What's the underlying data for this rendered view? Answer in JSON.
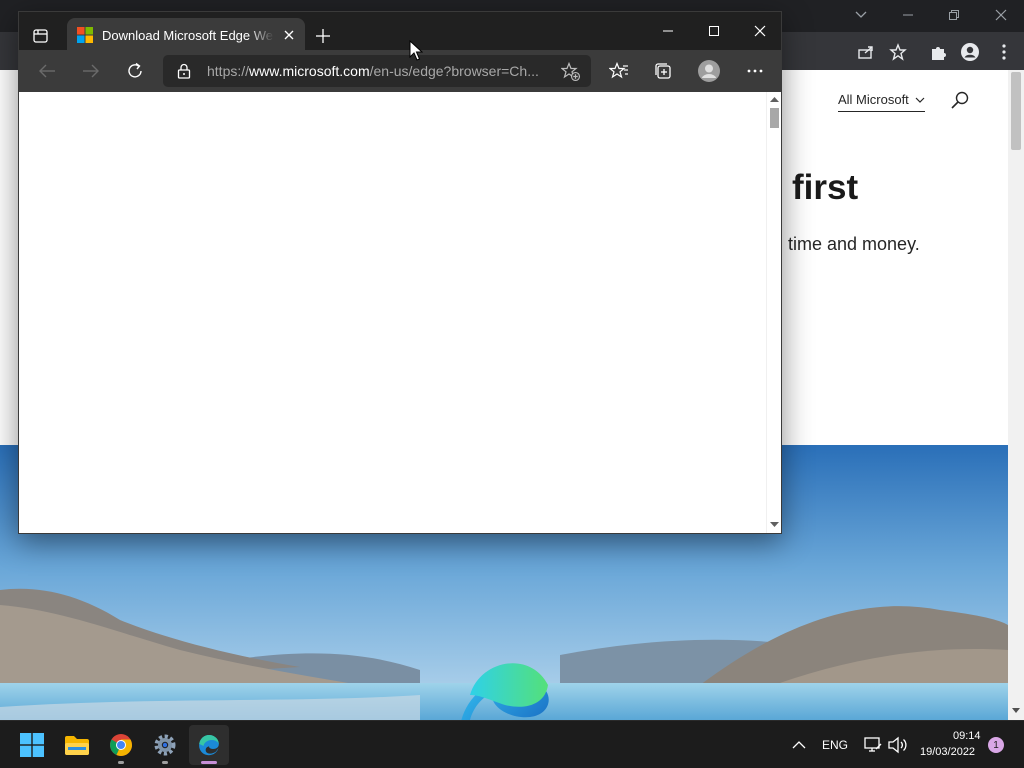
{
  "background_window": {
    "nav_label": "All Microsoft",
    "heading": "first",
    "subtext": "time and money."
  },
  "edge": {
    "tab_title": "Download Microsoft Edge Web Browser | Microsoft",
    "url_prefix": "https://",
    "url_host": "www.microsoft.com",
    "url_path": "/en-us/edge?browser=Ch..."
  },
  "taskbar": {
    "apps": [
      "start-icon",
      "file-explorer-icon",
      "chrome-icon",
      "settings-icon",
      "edge-icon"
    ],
    "language": "ENG",
    "time": "09:14",
    "date": "19/03/2022",
    "notification_count": "1"
  },
  "colors": {
    "taskbar_bg": "#1c1c1c",
    "edge_titlebar": "#202020",
    "edge_toolbar": "#3b3b3b",
    "chrome_titlebar": "#202124",
    "notification_badge": "#d9a7e6"
  }
}
